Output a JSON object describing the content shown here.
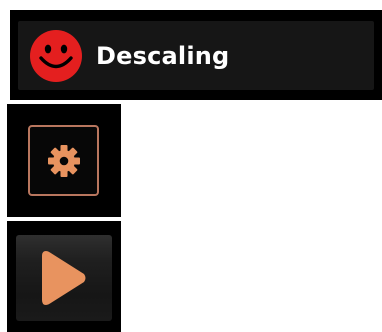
{
  "status": {
    "label": "Descaling",
    "face_icon": "red-smiley-face-icon",
    "face_color": "#e41f1f"
  },
  "settings": {
    "icon": "gear-icon",
    "accent_color": "#e8935f",
    "border_color": "#b8765e"
  },
  "play": {
    "icon": "play-icon",
    "accent_color": "#e8935f"
  }
}
